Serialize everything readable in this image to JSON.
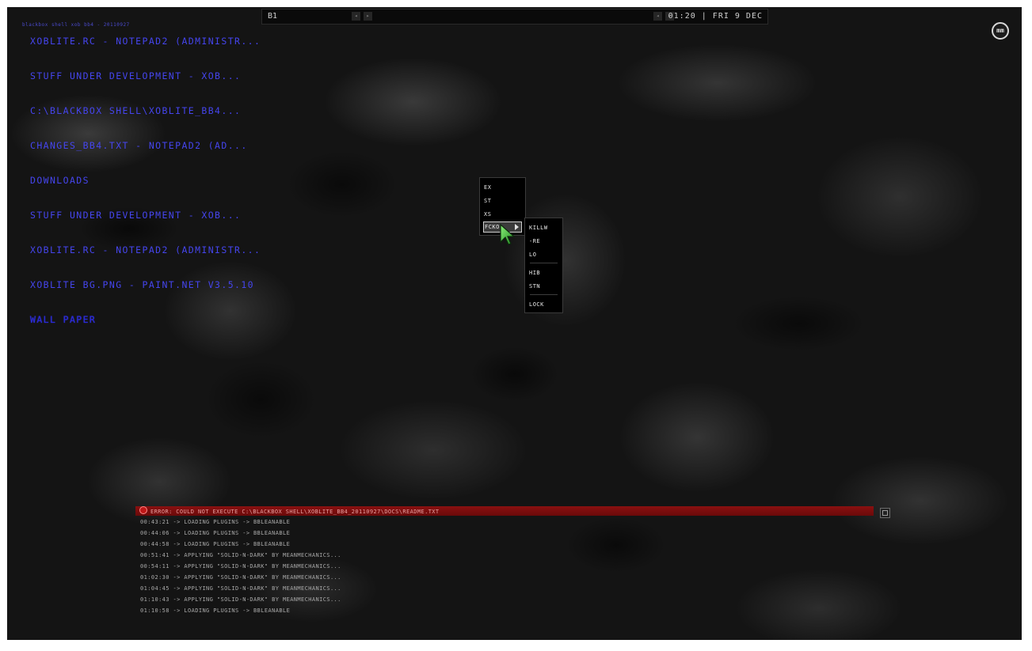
{
  "toolbar": {
    "workspace": "B1",
    "clock": "01:20 | FRI 9 DEC",
    "nav_prev": "◂",
    "nav_next": "▸"
  },
  "desktop": {
    "small_label": "blackbox shell xob bb4 - 20110927",
    "logo": "mm"
  },
  "tasks": [
    "XOBLITE.RC - NOTEPAD2 (ADMINISTR...",
    "STUFF UNDER DEVELOPMENT - XOB...",
    "C:\\BLACKBOX SHELL\\XOBLITE_BB4...",
    "CHANGES_BB4.TXT - NOTEPAD2 (AD...",
    "DOWNLOADS",
    "STUFF UNDER DEVELOPMENT - XOB...",
    "XOBLITE.RC - NOTEPAD2 (ADMINISTR...",
    "XOBLITE BG.PNG - PAINT.NET V3.5.10",
    "WALL PAPER"
  ],
  "menu": {
    "items": [
      "EX",
      "ST",
      "XS",
      "FCKO"
    ],
    "submenu": {
      "items": [
        "KILLW",
        "-RE",
        "LO",
        "HIB",
        "STN",
        "LOCK"
      ]
    }
  },
  "console": {
    "error": "ERROR: COULD NOT EXECUTE C:\\BLACKBOX SHELL\\XOBLITE_BB4_20110927\\DOCS\\README.TXT",
    "lines": [
      "00:43:21 -> LOADING PLUGINS -> BBLEANABLE",
      "00:44:06 -> LOADING PLUGINS -> BBLEANABLE",
      "00:44:58 -> LOADING PLUGINS -> BBLEANABLE",
      "00:51:41 -> APPLYING \"SOLID-N-DARK\" BY MEANMECHANICS...",
      "00:54:11 -> APPLYING \"SOLID-N-DARK\" BY MEANMECHANICS...",
      "01:02:30 -> APPLYING \"SOLID-N-DARK\" BY MEANMECHANICS...",
      "01:04:45 -> APPLYING \"SOLID-N-DARK\" BY MEANMECHANICS...",
      "01:10:43 -> APPLYING \"SOLID-N-DARK\" BY MEANMECHANICS...",
      "01:10:58 -> LOADING PLUGINS -> BBLEANABLE"
    ]
  },
  "colors": {
    "task_text": "#4545ee",
    "error_bar": "#8a1010"
  }
}
